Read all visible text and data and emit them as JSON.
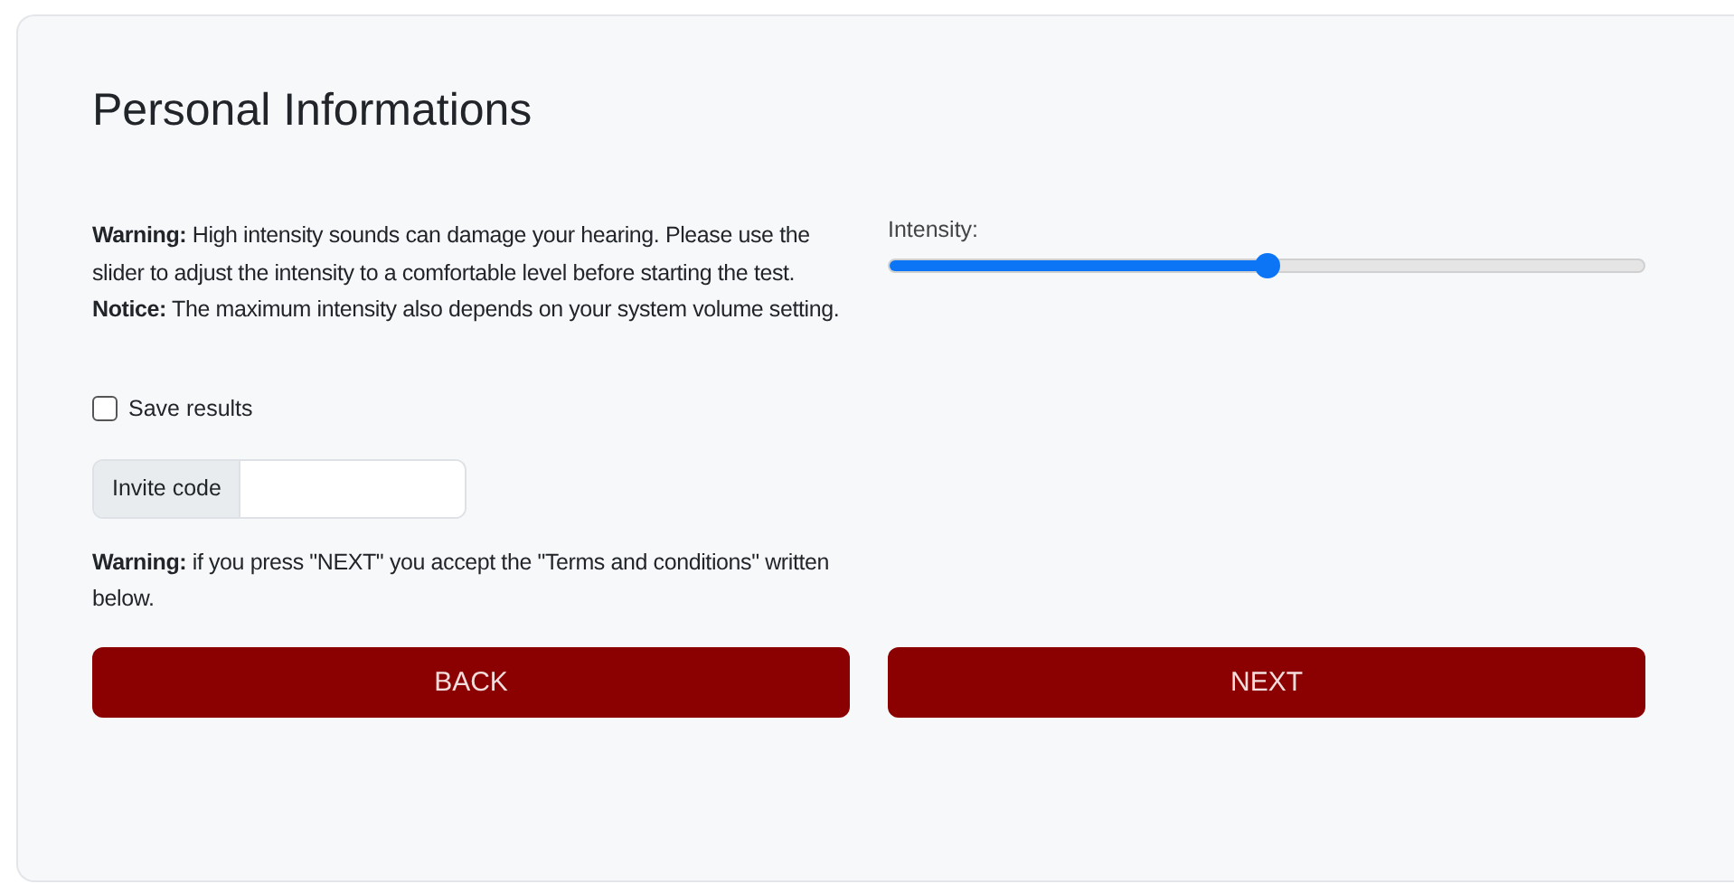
{
  "title": "Personal Informations",
  "warning": "**Warning:** High intensity sounds can damage your hearing. Please use the slider to adjust the intensity to a comfortable level before starting the test.",
  "notice": "**Notice:** The maximum intensity also depends on your system volume setting.",
  "intensity": {
    "label": "Intensity:",
    "level": 0.5
  },
  "save_results": {
    "label": "Save results",
    "checked": false
  },
  "invite_code": {
    "label": "Invite code"
  },
  "terms_warning": "**Warning:** if you press \"NEXT\" you accept the \"Terms and conditions\" written below.",
  "buttons": [
    "BACK",
    "NEXT"
  ]
}
